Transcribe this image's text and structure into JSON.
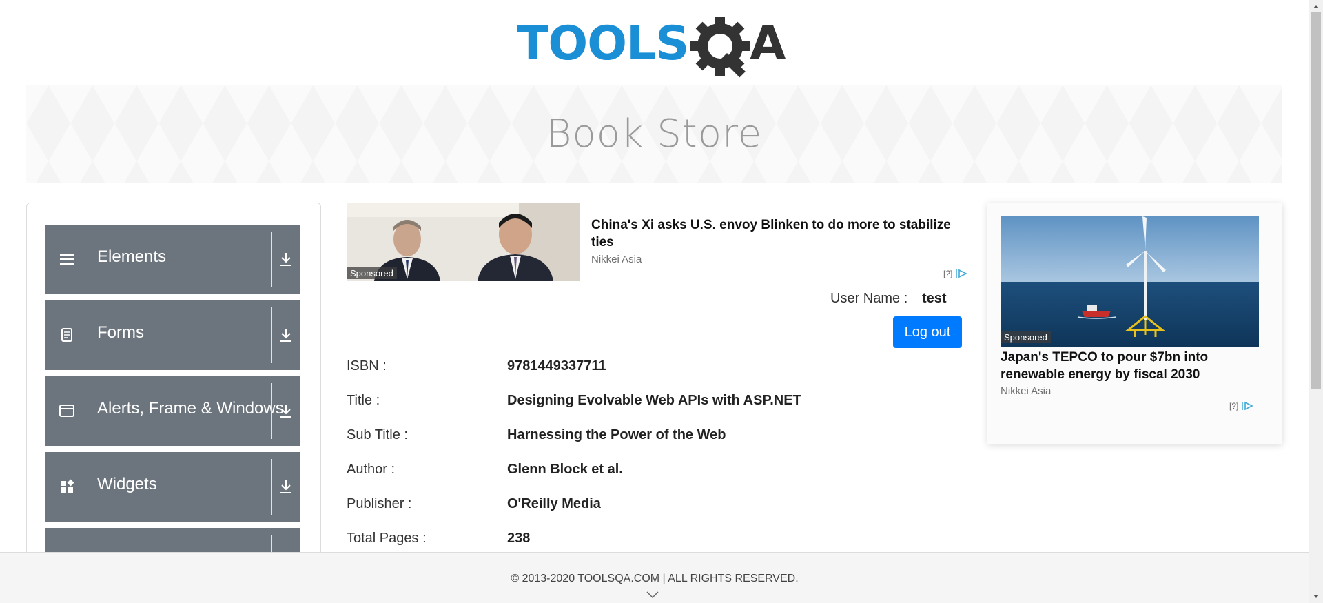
{
  "logo": {
    "text_left": "TOOLS",
    "text_right": "A"
  },
  "banner": {
    "title": "Book Store"
  },
  "sidebar": {
    "groups": [
      {
        "label": "Elements",
        "icon": "hamburger-icon"
      },
      {
        "label": "Forms",
        "icon": "document-icon"
      },
      {
        "label": "Alerts, Frame & Windows",
        "icon": "window-icon"
      },
      {
        "label": "Widgets",
        "icon": "widgets-icon"
      },
      {
        "label": "",
        "icon": ""
      }
    ]
  },
  "ads": {
    "top": {
      "sponsored": "Sponsored",
      "headline": "China's Xi asks U.S. envoy Blinken to do more to stabilize ties",
      "source": "Nikkei Asia",
      "choices": "[?]"
    },
    "side": {
      "sponsored": "Sponsored",
      "headline": "Japan's TEPCO to pour $7bn into renewable energy by fiscal 2030",
      "source": "Nikkei Asia",
      "choices": "[?]"
    }
  },
  "user": {
    "label": "User Name :",
    "value": "test",
    "logout": "Log out"
  },
  "book": [
    {
      "key": "ISBN :",
      "value": "9781449337711"
    },
    {
      "key": "Title :",
      "value": "Designing Evolvable Web APIs with ASP.NET"
    },
    {
      "key": "Sub Title :",
      "value": "Harnessing the Power of the Web"
    },
    {
      "key": "Author :",
      "value": "Glenn Block et al."
    },
    {
      "key": "Publisher :",
      "value": "O'Reilly Media"
    },
    {
      "key": "Total Pages :",
      "value": "238"
    }
  ],
  "footer": {
    "text": "© 2013-2020 TOOLSQA.COM | ALL RIGHTS RESERVED."
  },
  "colors": {
    "sidebar_group": "#6c757d",
    "logout_button": "#007bff",
    "logo_blue": "#1a8fd6",
    "logo_dark": "#333333"
  }
}
